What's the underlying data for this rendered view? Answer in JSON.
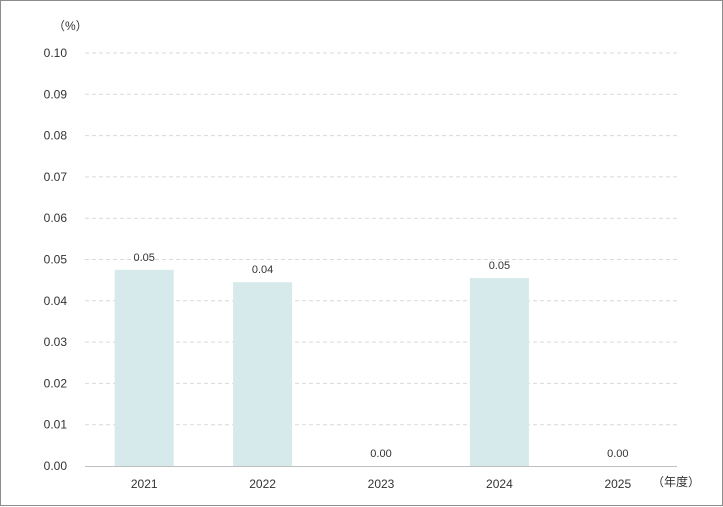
{
  "chart_data": {
    "type": "bar",
    "categories": [
      "2021",
      "2022",
      "2023",
      "2024",
      "2025"
    ],
    "values": [
      0.0475,
      0.0445,
      0.0,
      0.0455,
      0.0
    ],
    "data_labels": [
      "0.05",
      "0.04",
      "0.00",
      "0.05",
      "0.00"
    ],
    "y_unit_label": "（%）",
    "x_unit_label": "（年度）",
    "ylim": [
      0,
      0.1
    ],
    "y_ticks": [
      "0.00",
      "0.01",
      "0.02",
      "0.03",
      "0.04",
      "0.05",
      "0.06",
      "0.07",
      "0.08",
      "0.09",
      "0.10"
    ],
    "grid": true,
    "legend": "none",
    "colors": {
      "bar": "#d6e9eb",
      "grid": "#d9d9d9",
      "axis": "#bfbfbf",
      "text": "#333333"
    }
  }
}
